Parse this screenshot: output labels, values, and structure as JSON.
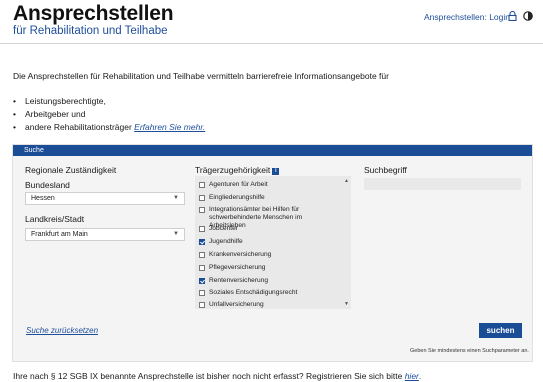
{
  "header": {
    "title": "Ansprechstellen",
    "subtitle": "für Rehabilitation und Teilhabe",
    "login_label": "Ansprechstellen: Login",
    "lock_icon": "lock-icon",
    "contrast_icon": "contrast-icon"
  },
  "intro": {
    "text": "Die Ansprechstellen für Rehabilitation und Teilhabe vermitteln barrierefreie Informationsangebote für",
    "bullets": [
      "Leistungsberechtigte,",
      "Arbeitgeber und",
      "andere Rehabilitationsträger"
    ],
    "more_link": "Erfahren Sie mehr."
  },
  "search": {
    "header": "Suche",
    "regional_title": "Regionale Zuständigkeit",
    "state_label": "Bundesland",
    "state_value": "Hessen",
    "district_label": "Landkreis/Stadt",
    "district_value": "Frankfurt am Main",
    "carrier_title": "Trägerzugehörigkeit",
    "info_icon": "i",
    "carriers": [
      {
        "label": "Agenturen für Arbeit",
        "checked": false
      },
      {
        "label": "Eingliederungshilfe",
        "checked": false
      },
      {
        "label": "Integrationsämter bei Hilfen für schwerbehinderte Menschen im Arbeitsleben",
        "checked": false
      },
      {
        "label": "Jobcenter",
        "checked": false
      },
      {
        "label": "Jugendhilfe",
        "checked": true
      },
      {
        "label": "Krankenversicherung",
        "checked": false
      },
      {
        "label": "Pflegeversicherung",
        "checked": false
      },
      {
        "label": "Rentenversicherung",
        "checked": true
      },
      {
        "label": "Soziales Entschädigungsrecht",
        "checked": false
      },
      {
        "label": "Unfallversicherung",
        "checked": false
      }
    ],
    "keyword_title": "Suchbegriff",
    "keyword_value": "",
    "reset_label": "Suche zurücksetzen",
    "submit_label": "suchen",
    "hint": "Geben Sie mindestens einen Suchparameter an."
  },
  "footer": {
    "text": "Ihre nach § 12 SGB IX benannte Ansprechstelle ist bisher noch nicht erfasst? Registrieren Sie sich bitte ",
    "link": "hier",
    "suffix": "."
  }
}
